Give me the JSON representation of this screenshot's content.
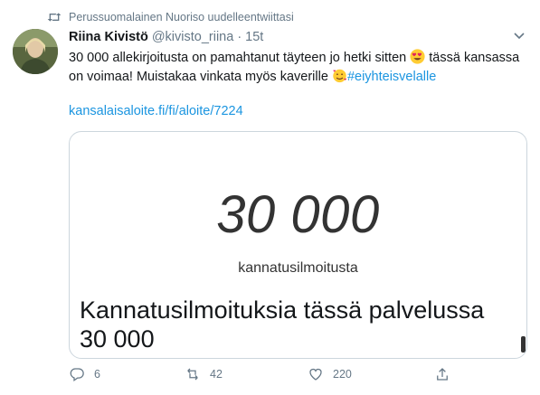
{
  "retweet_header": {
    "text": "Perussuomalainen Nuoriso uudelleentwiittasi",
    "icon": "retweet-icon"
  },
  "tweet": {
    "author_name": "Riina Kivistö",
    "handle": "@kivisto_riina",
    "separator": "·",
    "time": "15t",
    "text_part1": "30 000 allekirjoitusta on pamahtanut täyteen jo hetki sitten ",
    "text_part2": " tässä kansassa on voimaa! Muistakaa vinkata myös kaverille ",
    "hashtag": "#eiyhteisvelalle",
    "link": "kansalaisaloite.fi/fi/aloite/7224"
  },
  "card": {
    "count": "30 000",
    "count_label": "kannatusilmoitusta",
    "title_line1": "Kannatusilmoituksia tässä palvelussa",
    "title_line2": "30 000"
  },
  "actions": {
    "reply_count": "6",
    "retweet_count": "42",
    "like_count": "220"
  },
  "colors": {
    "accent": "#1b95e0",
    "muted": "#657786",
    "text": "#14171a"
  }
}
